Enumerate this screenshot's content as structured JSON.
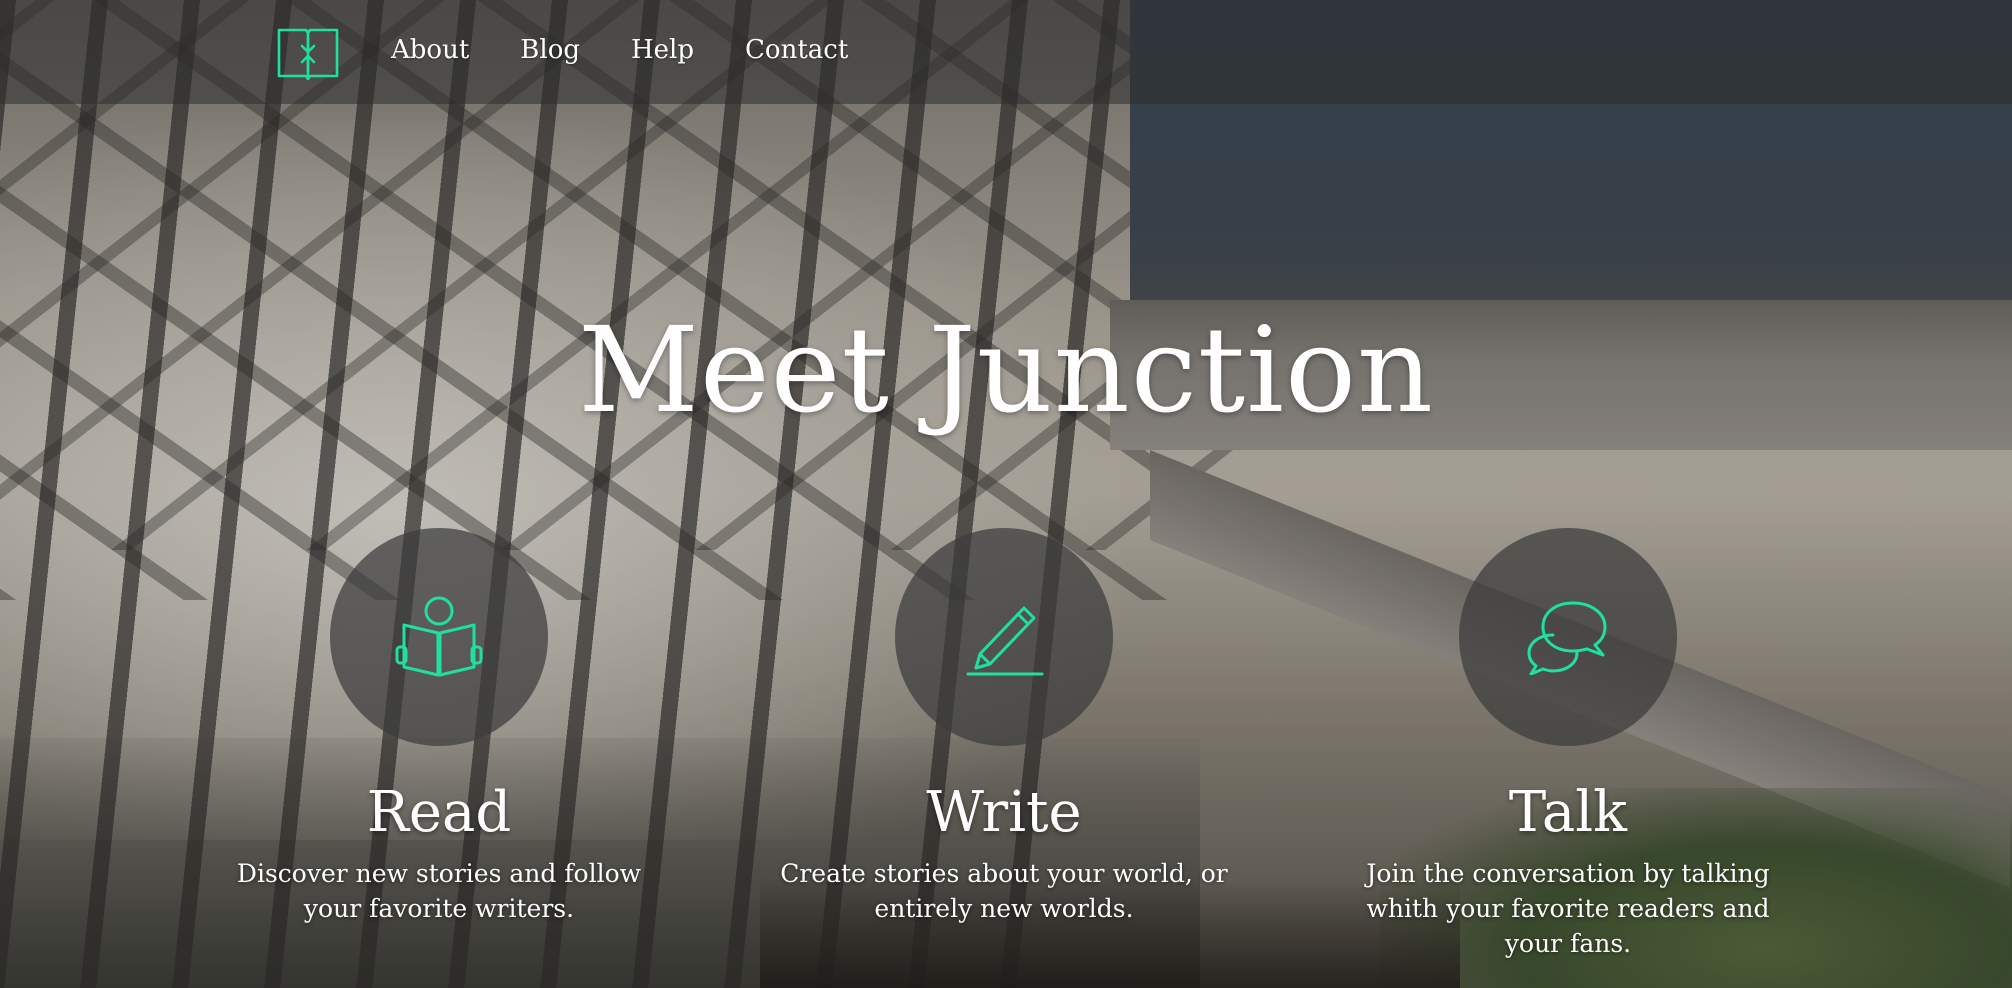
{
  "nav": {
    "logo_icon": "book-arrows-logo-icon",
    "links": [
      {
        "label": "About"
      },
      {
        "label": "Blog"
      },
      {
        "label": "Help"
      },
      {
        "label": "Contact"
      }
    ]
  },
  "hero": {
    "title": "Meet Junction"
  },
  "features": [
    {
      "icon": "open-book-reader-icon",
      "label": "Read",
      "description": "Discover new stories and follow your favorite writers."
    },
    {
      "icon": "pencil-icon",
      "label": "Write",
      "description": "Create stories about your world, or entirely new worlds."
    },
    {
      "icon": "speech-bubbles-icon",
      "label": "Talk",
      "description": "Join the conversation by talking whith your favorite readers and your fans."
    }
  ],
  "colors": {
    "accent": "#1fe0a0",
    "overlay": "#3c3c3c"
  }
}
